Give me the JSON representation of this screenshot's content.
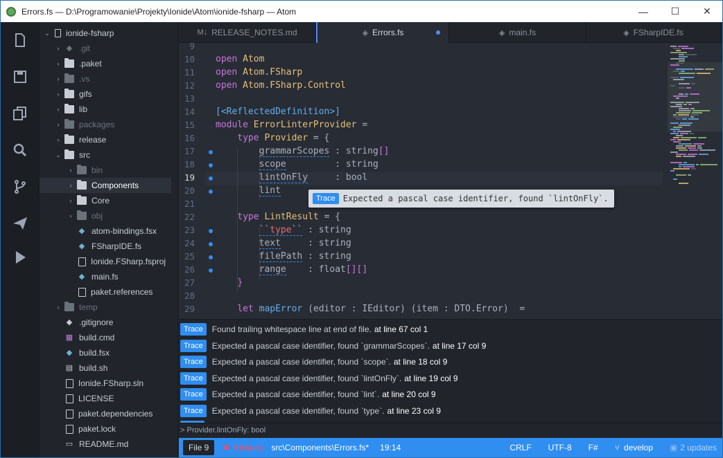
{
  "window": {
    "title": "Errors.fs — D:\\Programowanie\\Projekty\\Ionide\\Atom\\ionide-fsharp — Atom",
    "minimize": "—",
    "maximize": "☐",
    "close": "✕"
  },
  "iconbar": [
    "file-icon",
    "save-icon",
    "copy-icon",
    "search-icon",
    "git-branch-icon",
    "send-icon",
    "run-icon"
  ],
  "tree": {
    "root": "ionide-fsharp",
    "items": [
      {
        "label": ".git",
        "kind": "git",
        "depth": 1,
        "chev": "›",
        "dim": true
      },
      {
        "label": ".paket",
        "kind": "folder",
        "depth": 1,
        "chev": "›"
      },
      {
        "label": ".vs",
        "kind": "folder",
        "depth": 1,
        "chev": "›",
        "dim": true
      },
      {
        "label": "gifs",
        "kind": "folder",
        "depth": 1,
        "chev": "›"
      },
      {
        "label": "lib",
        "kind": "folder",
        "depth": 1,
        "chev": "›"
      },
      {
        "label": "packages",
        "kind": "folder",
        "depth": 1,
        "chev": "›",
        "dim": true
      },
      {
        "label": "release",
        "kind": "folder",
        "depth": 1,
        "chev": "›"
      },
      {
        "label": "src",
        "kind": "folder",
        "depth": 1,
        "chev": "⌄"
      },
      {
        "label": "bin",
        "kind": "folder",
        "depth": 2,
        "chev": "›",
        "dim": true
      },
      {
        "label": "Components",
        "kind": "folder",
        "depth": 2,
        "chev": "›",
        "sel": true
      },
      {
        "label": "Core",
        "kind": "folder",
        "depth": 2,
        "chev": "›"
      },
      {
        "label": "obj",
        "kind": "folder",
        "depth": 2,
        "chev": "›",
        "dim": true
      },
      {
        "label": "atom-bindings.fsx",
        "kind": "fs",
        "depth": 2
      },
      {
        "label": "FSharpIDE.fs",
        "kind": "fs",
        "depth": 2
      },
      {
        "label": "Ionide.FSharp.fsproj",
        "kind": "file",
        "depth": 2
      },
      {
        "label": "main.fs",
        "kind": "fs",
        "depth": 2
      },
      {
        "label": "paket.references",
        "kind": "file",
        "depth": 2
      },
      {
        "label": "temp",
        "kind": "folder",
        "depth": 1,
        "chev": "›",
        "dim": true
      },
      {
        "label": ".gitignore",
        "kind": "git",
        "depth": 1
      },
      {
        "label": "build.cmd",
        "kind": "win",
        "depth": 1
      },
      {
        "label": "build.fsx",
        "kind": "fs",
        "depth": 1
      },
      {
        "label": "build.sh",
        "kind": "term",
        "depth": 1
      },
      {
        "label": "Ionide.FSharp.sln",
        "kind": "file",
        "depth": 1
      },
      {
        "label": "LICENSE",
        "kind": "file",
        "depth": 1
      },
      {
        "label": "paket.dependencies",
        "kind": "file",
        "depth": 1
      },
      {
        "label": "paket.lock",
        "kind": "file",
        "depth": 1
      },
      {
        "label": "README.md",
        "kind": "md",
        "depth": 1
      }
    ]
  },
  "tabs": [
    {
      "label": "RELEASE_NOTES.md",
      "icon": "M↓",
      "active": false
    },
    {
      "label": "Errors.fs",
      "icon": "◈",
      "active": true,
      "modified": true
    },
    {
      "label": "main.fs",
      "icon": "◈",
      "active": false
    },
    {
      "label": "FSharpIDE.fs",
      "icon": "◈",
      "active": false
    }
  ],
  "editor": {
    "current_line": 19,
    "lines": [
      {
        "n": 9,
        "html": ""
      },
      {
        "n": 10,
        "html": "<span class='kw'>open</span> <span class='ty'>Atom</span>"
      },
      {
        "n": 11,
        "html": "<span class='kw'>open</span> <span class='ty'>Atom.FSharp</span>"
      },
      {
        "n": 12,
        "html": "<span class='kw'>open</span> <span class='ty'>Atom.FSharp.Control</span>"
      },
      {
        "n": 13,
        "html": ""
      },
      {
        "n": 14,
        "html": "<span class='id'>[&lt;ReflectedDefinition&gt;]</span>"
      },
      {
        "n": 15,
        "html": "<span class='kw'>module</span> <span class='ty'>ErrorLinterProvider</span> <span class='pu'>=</span>"
      },
      {
        "n": 16,
        "html": "    <span class='kw'>type</span> <span class='ty'>Provider</span> <span class='pu'>= {</span>"
      },
      {
        "n": 17,
        "html": "        <span class='err'>grammarScopes</span> : string<span class='kw'>[]</span>",
        "dot": true
      },
      {
        "n": 18,
        "html": "        <span class='err'>scope</span>         : string",
        "dot": true
      },
      {
        "n": 19,
        "html": "        <span class='err'>lintOnFly</span>     : bool",
        "dot": true
      },
      {
        "n": 20,
        "html": "        <span class='err'>lint</span>",
        "dot": true
      },
      {
        "n": 21,
        "html": ""
      },
      {
        "n": 22,
        "html": "    <span class='kw'>type</span> <span class='ty'>LintResult</span> <span class='pu'>= {</span>"
      },
      {
        "n": 23,
        "html": "        <span class='err'>``<span class='str'>type</span>``</span> : string",
        "dot": true
      },
      {
        "n": 24,
        "html": "        <span class='err'>text</span>     : string",
        "dot": true
      },
      {
        "n": 25,
        "html": "        <span class='err'>filePath</span> : string",
        "dot": true
      },
      {
        "n": 26,
        "html": "        <span class='err'>range</span>    : float<span class='kw'>[][]</span>",
        "dot": true
      },
      {
        "n": 27,
        "html": "    <span class='kw'>}</span>"
      },
      {
        "n": 28,
        "html": ""
      },
      {
        "n": 29,
        "html": "    <span class='kw'>let</span> <span class='id'>mapError</span> (editor : IEditor) (item : DTO.Error)  ="
      }
    ]
  },
  "tooltip": {
    "badge": "Trace",
    "message": "Expected a pascal case identifier, found `lintOnFly`."
  },
  "panel": {
    "messages": [
      {
        "badge": "Trace",
        "text": "Found trailing whitespace line at end of file.",
        "loc": "at line 67 col 1"
      },
      {
        "badge": "Trace",
        "text": "Expected a pascal case identifier, found `grammarScopes`.",
        "loc": "at line 17 col 9"
      },
      {
        "badge": "Trace",
        "text": "Expected a pascal case identifier, found `scope`.",
        "loc": "at line 18 col 9"
      },
      {
        "badge": "Trace",
        "text": "Expected a pascal case identifier, found `lintOnFly`.",
        "loc": "at line 19 col 9"
      },
      {
        "badge": "Trace",
        "text": "Expected a pascal case identifier, found `lint`.",
        "loc": "at line 20 col 9"
      },
      {
        "badge": "Trace",
        "text": "Expected a pascal case identifier, found `type`.",
        "loc": "at line 23 col 9"
      }
    ],
    "path_hint": "> Provider.lintOnFly: bool"
  },
  "status": {
    "file_button": "File  9",
    "issues": "9 issues",
    "path": "src\\Components\\Errors.fs*",
    "cursor": "19:14",
    "line_ending": "CRLF",
    "encoding": "UTF-8",
    "grammar": "F#",
    "branch": "develop",
    "updates": "2 updates"
  }
}
